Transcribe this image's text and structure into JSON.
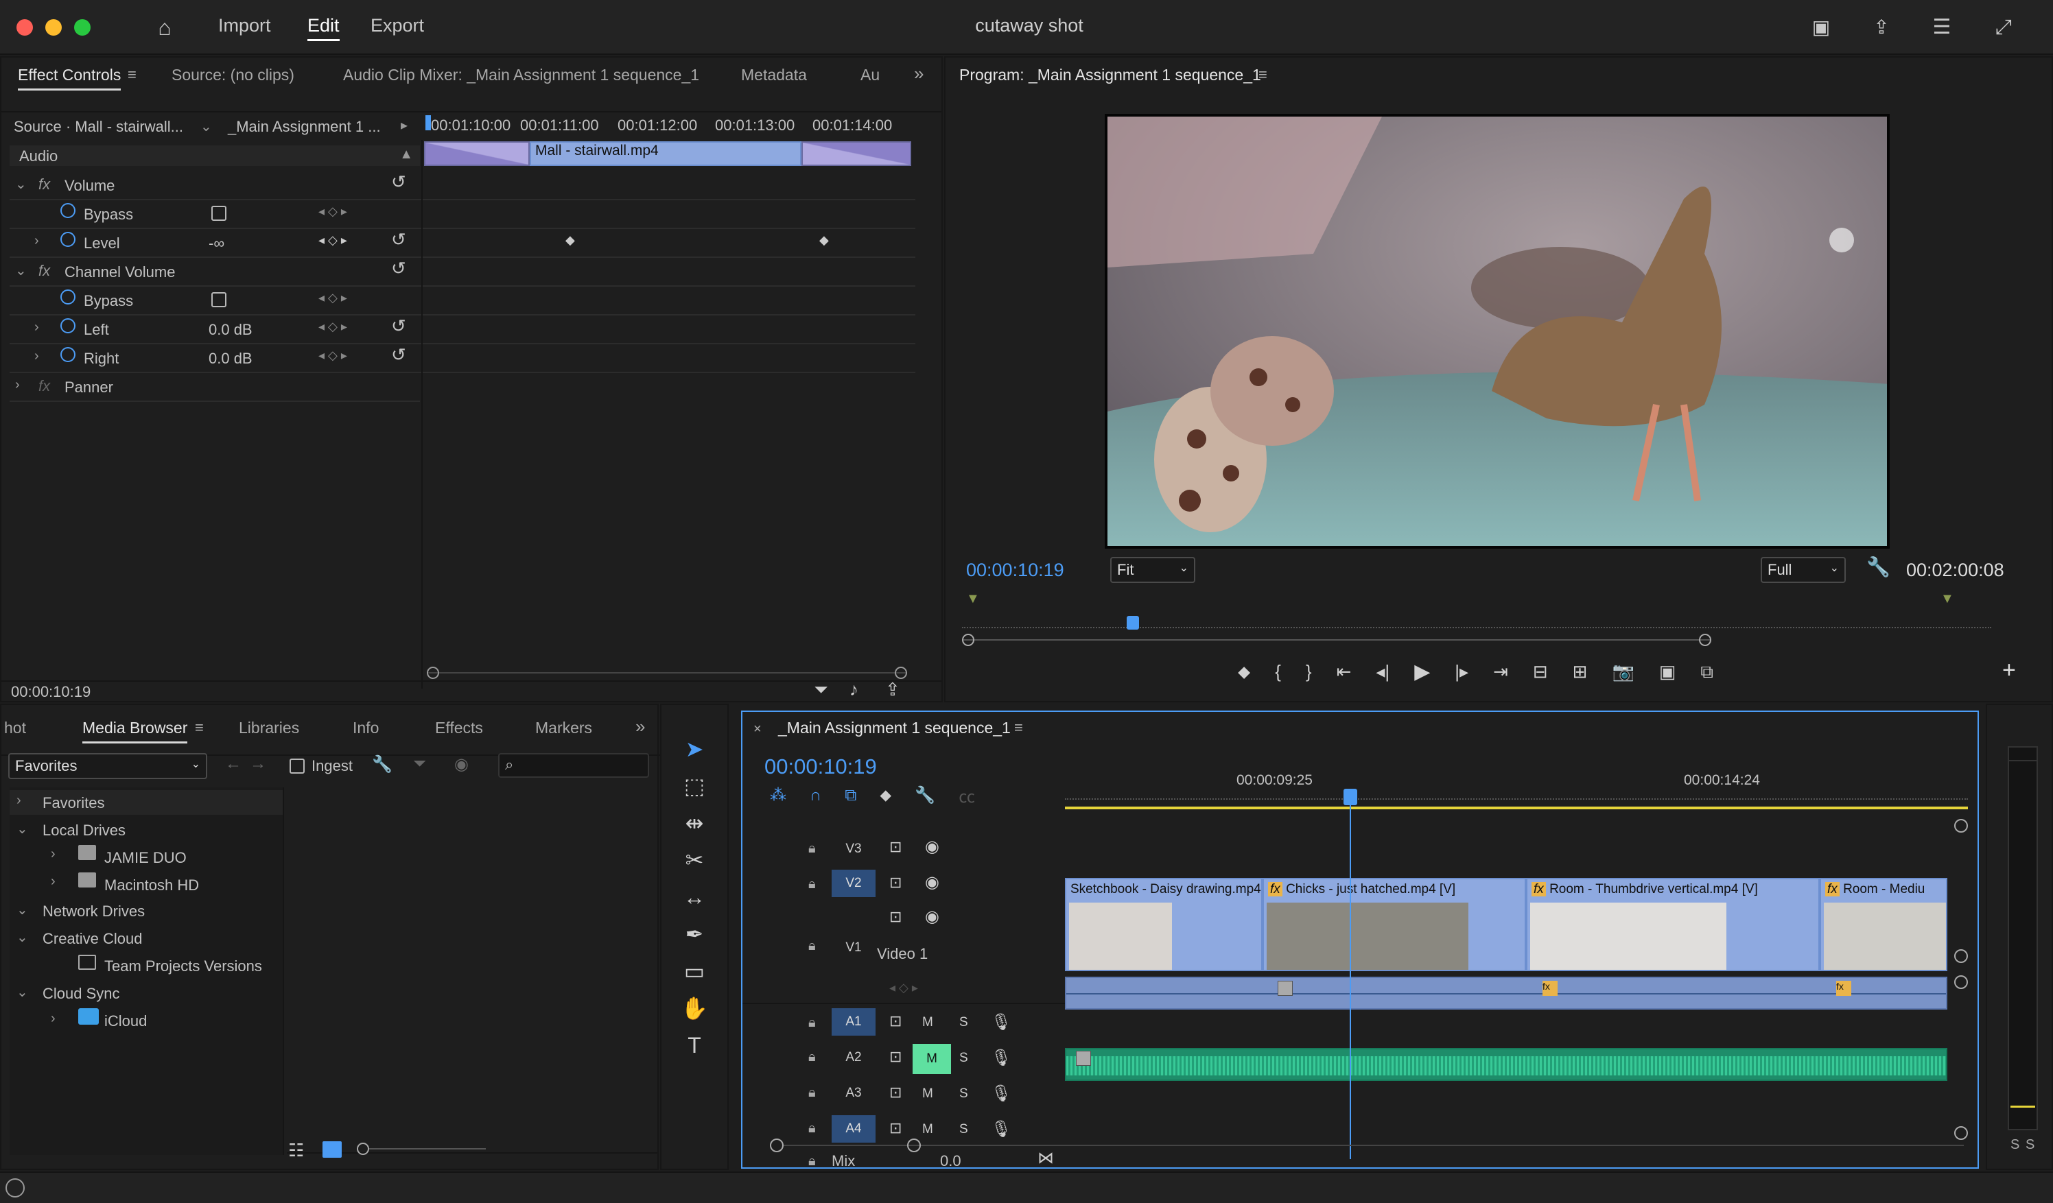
{
  "app": {
    "title": "cutaway shot",
    "nav": [
      "Import",
      "Edit",
      "Export"
    ],
    "active_nav": "Edit"
  },
  "effect_controls": {
    "tabs": [
      "Effect Controls",
      "Source: (no clips)",
      "Audio Clip Mixer: _Main Assignment 1 sequence_1",
      "Metadata",
      "Au"
    ],
    "source_label": "Source · Mall - stairwall...",
    "sequence_label": "_Main Assignment 1 ...",
    "ruler": [
      "00:01:10:00",
      "00:01:11:00",
      "00:01:12:00",
      "00:01:13:00",
      "00:01:14:00"
    ],
    "clip_name": "Mall - stairwall.mp4",
    "section": "Audio",
    "rows": {
      "volume": "Volume",
      "bypass1": "Bypass",
      "level": "Level",
      "level_val": "-∞",
      "channel_volume": "Channel Volume",
      "bypass2": "Bypass",
      "left": "Left",
      "left_val": "0.0 dB",
      "right": "Right",
      "right_val": "0.0 dB",
      "panner": "Panner"
    },
    "timecode": "00:00:10:19"
  },
  "program": {
    "title": "Program: _Main Assignment 1 sequence_1",
    "timecode": "00:00:10:19",
    "fit": "Fit",
    "quality": "Full",
    "duration": "00:02:00:08"
  },
  "project": {
    "tabs": [
      "hot",
      "Media Browser",
      "Libraries",
      "Info",
      "Effects",
      "Markers"
    ],
    "favorites_dd": "Favorites",
    "ingest": "Ingest",
    "tree": [
      "Favorites",
      "Local Drives",
      "JAMIE DUO",
      "Macintosh HD",
      "Network Drives",
      "Creative Cloud",
      "Team Projects Versions",
      "Cloud Sync",
      "iCloud"
    ]
  },
  "timeline": {
    "title": "_Main Assignment 1 sequence_1",
    "timecode": "00:00:10:19",
    "ruler": [
      "00:00:09:25",
      "00:00:14:24"
    ],
    "tracks": {
      "v3": "V3",
      "v2": "V2",
      "v1": "V1",
      "video1": "Video 1",
      "a1": "A1",
      "a2": "A2",
      "a3": "A3",
      "a4": "A4",
      "mix": "Mix",
      "mix_val": "0.0",
      "m": "M",
      "s": "S"
    },
    "clips": [
      "Sketchbook - Daisy drawing.mp4",
      "Chicks - just hatched.mp4 [V]",
      "Room - Thumbdrive vertical.mp4 [V]",
      "Room - Mediu"
    ]
  },
  "meter": {
    "s1": "S",
    "s2": "S"
  },
  "colors": {
    "accent": "#4c9cf5",
    "clip_video": "#8ea9e0",
    "clip_audio_green": "#24a37a",
    "mute_active": "#5fe0a0"
  }
}
